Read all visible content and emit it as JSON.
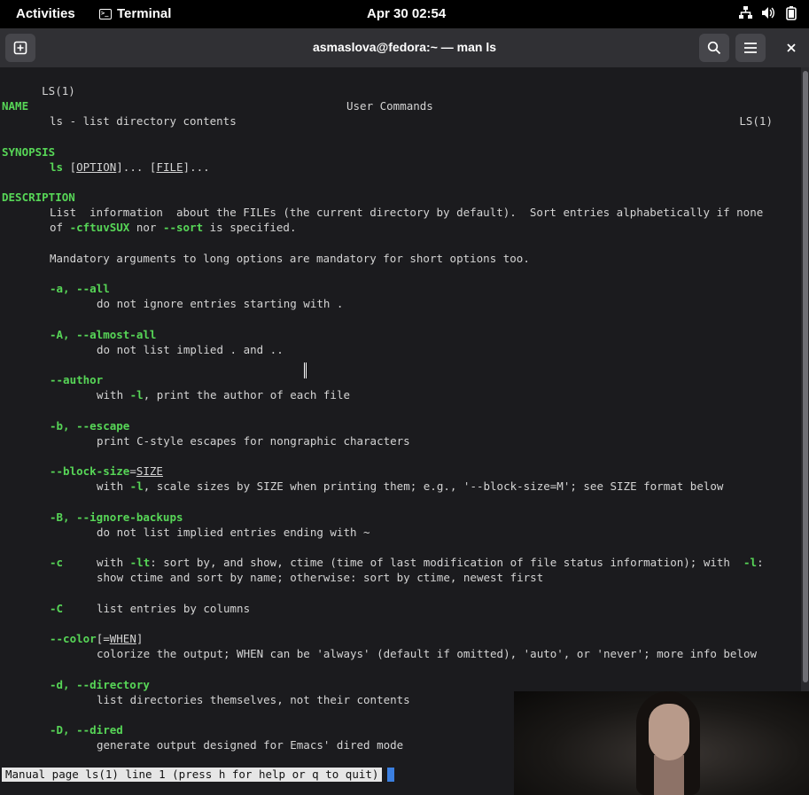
{
  "topbar": {
    "activities": "Activities",
    "app_name": "Terminal",
    "clock": "Apr 30  02:54",
    "tray_icons": [
      "network-icon",
      "volume-icon",
      "battery-icon"
    ]
  },
  "window": {
    "title": "asmaslova@fedora:~ — man ls"
  },
  "man": {
    "header_left": "LS(1)",
    "header_center": "User Commands",
    "header_right": "LS(1)",
    "name_heading": "NAME",
    "name_text": "ls - list directory contents",
    "synopsis_heading": "SYNOPSIS",
    "synopsis_cmd": "ls",
    "synopsis_option": "OPTION",
    "synopsis_file": "FILE",
    "description_heading": "DESCRIPTION",
    "desc_line1": "List  information  about the FILEs (the current directory by default).  Sort entries alphabetically if none",
    "desc_line2_a": "of ",
    "desc_line2_flag1": "-cftuvSUX",
    "desc_line2_b": " nor ",
    "desc_line2_flag2": "--sort",
    "desc_line2_c": " is specified.",
    "mandatory": "Mandatory arguments to long options are mandatory for short options too.",
    "options": {
      "all_flag": "-a, --all",
      "all_desc": "do not ignore entries starting with .",
      "almost_all_flag": "-A, --almost-all",
      "almost_all_desc": "do not list implied . and ..",
      "author_flag": "--author",
      "author_desc_a": "with ",
      "author_desc_flag": "-l",
      "author_desc_b": ", print the author of each file",
      "escape_flag": "-b, --escape",
      "escape_desc": "print C-style escapes for nongraphic characters",
      "block_flag": "--block-size",
      "block_arg": "SIZE",
      "block_desc_a": "with ",
      "block_desc_flag": "-l",
      "block_desc_b": ", scale sizes by SIZE when printing them; e.g., '--block-size=M'; see SIZE format below",
      "ignore_backups_flag": "-B, --ignore-backups",
      "ignore_backups_desc": "do not list implied entries ending with ~",
      "c_flag": "-c",
      "c_desc1_a": "with ",
      "c_desc1_flag": "-lt",
      "c_desc1_b": ": sort by, and show, ctime (time of last modification of file status information); with  ",
      "c_desc1_flag2": "-l",
      "c_desc1_c": ":",
      "c_desc2": "show ctime and sort by name; otherwise: sort by ctime, newest first",
      "C_flag": "-C",
      "C_desc": "list entries by columns",
      "color_flag": "--color",
      "color_arg": "WHEN",
      "color_desc": "colorize the output; WHEN can be 'always' (default if omitted), 'auto', or 'never'; more info below",
      "directory_flag": "-d, --directory",
      "directory_desc": "list directories themselves, not their contents",
      "dired_flag": "-D, --dired",
      "dired_desc": "generate output designed for Emacs' dired mode"
    },
    "status": "Manual page ls(1) line 1 (press h for help or q to quit)"
  }
}
